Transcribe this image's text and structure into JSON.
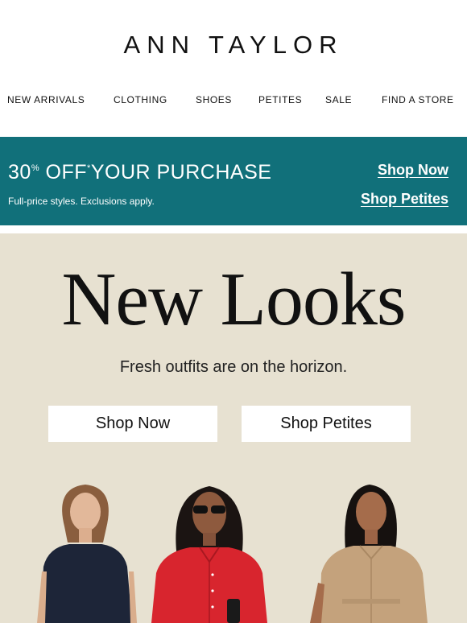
{
  "header": {
    "logo": "ANN TAYLOR",
    "nav": [
      {
        "label": "NEW ARRIVALS"
      },
      {
        "label": "CLOTHING"
      },
      {
        "label": "SHOES"
      },
      {
        "label": "PETITES"
      },
      {
        "label": "SALE"
      },
      {
        "label": "FIND A STORE"
      }
    ]
  },
  "promo": {
    "percent": "30",
    "percent_sign": "%",
    "headline_rest": "OFF",
    "asterisk": "*",
    "headline_tail": "YOUR PURCHASE",
    "subtext": "Full-price styles. Exclusions apply.",
    "link_shop_now": "Shop Now",
    "link_shop_petites": "Shop Petites",
    "bg_color": "#11707a"
  },
  "hero": {
    "title": "New Looks",
    "subtitle": "Fresh outfits are on the horizon.",
    "button_shop_now": "Shop Now",
    "button_shop_petites": "Shop Petites",
    "bg_color": "#e7e1d1"
  }
}
